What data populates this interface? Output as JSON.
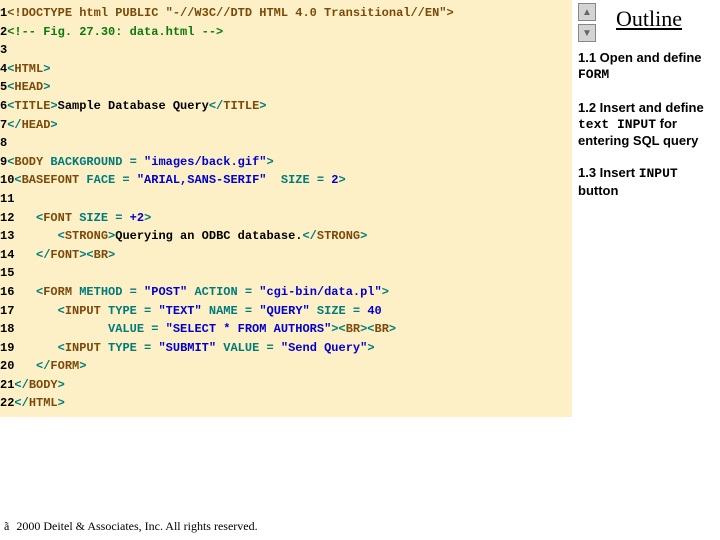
{
  "code": {
    "lines": [
      {
        "n": "1",
        "segs": [
          {
            "t": "<!DOCTYPE html PUBLIC \"-//W3C//DTD HTML 4.0 Transitional//EN\">",
            "c": "c-brown"
          }
        ]
      },
      {
        "n": "2",
        "segs": [
          {
            "t": "<!-- Fig. 27.30: data.html -->",
            "c": "c-green"
          }
        ]
      },
      {
        "n": "3",
        "segs": []
      },
      {
        "n": "4",
        "segs": [
          {
            "t": "<",
            "c": "c-teal"
          },
          {
            "t": "HTML",
            "c": "c-brown"
          },
          {
            "t": ">",
            "c": "c-teal"
          }
        ]
      },
      {
        "n": "5",
        "segs": [
          {
            "t": "<",
            "c": "c-teal"
          },
          {
            "t": "HEAD",
            "c": "c-brown"
          },
          {
            "t": ">",
            "c": "c-teal"
          }
        ]
      },
      {
        "n": "6",
        "segs": [
          {
            "t": "<",
            "c": "c-teal"
          },
          {
            "t": "TITLE",
            "c": "c-brown"
          },
          {
            "t": ">",
            "c": "c-teal"
          },
          {
            "t": "Sample Database Query",
            "c": "c-black"
          },
          {
            "t": "</",
            "c": "c-teal"
          },
          {
            "t": "TITLE",
            "c": "c-brown"
          },
          {
            "t": ">",
            "c": "c-teal"
          }
        ]
      },
      {
        "n": "7",
        "segs": [
          {
            "t": "</",
            "c": "c-teal"
          },
          {
            "t": "HEAD",
            "c": "c-brown"
          },
          {
            "t": ">",
            "c": "c-teal"
          }
        ]
      },
      {
        "n": "8",
        "segs": []
      },
      {
        "n": "9",
        "segs": [
          {
            "t": "<",
            "c": "c-teal"
          },
          {
            "t": "BODY ",
            "c": "c-brown"
          },
          {
            "t": "BACKGROUND = ",
            "c": "c-teal"
          },
          {
            "t": "\"images/back.gif\"",
            "c": "c-blue"
          },
          {
            "t": ">",
            "c": "c-teal"
          }
        ]
      },
      {
        "n": "10",
        "segs": [
          {
            "t": "<",
            "c": "c-teal"
          },
          {
            "t": "BASEFONT ",
            "c": "c-brown"
          },
          {
            "t": "FACE = ",
            "c": "c-teal"
          },
          {
            "t": "\"ARIAL,SANS-SERIF\" ",
            "c": "c-blue"
          },
          {
            "t": " SIZE = ",
            "c": "c-teal"
          },
          {
            "t": "2",
            "c": "c-blue"
          },
          {
            "t": ">",
            "c": "c-teal"
          }
        ]
      },
      {
        "n": "11",
        "segs": []
      },
      {
        "n": "12",
        "segs": [
          {
            "t": "   <",
            "c": "c-teal"
          },
          {
            "t": "FONT ",
            "c": "c-brown"
          },
          {
            "t": "SIZE = ",
            "c": "c-teal"
          },
          {
            "t": "+2",
            "c": "c-blue"
          },
          {
            "t": ">",
            "c": "c-teal"
          }
        ]
      },
      {
        "n": "13",
        "segs": [
          {
            "t": "      <",
            "c": "c-teal"
          },
          {
            "t": "STRONG",
            "c": "c-brown"
          },
          {
            "t": ">",
            "c": "c-teal"
          },
          {
            "t": "Querying an ODBC database.",
            "c": "c-black"
          },
          {
            "t": "</",
            "c": "c-teal"
          },
          {
            "t": "STRONG",
            "c": "c-brown"
          },
          {
            "t": ">",
            "c": "c-teal"
          }
        ]
      },
      {
        "n": "14",
        "segs": [
          {
            "t": "   </",
            "c": "c-teal"
          },
          {
            "t": "FONT",
            "c": "c-brown"
          },
          {
            "t": "><",
            "c": "c-teal"
          },
          {
            "t": "BR",
            "c": "c-brown"
          },
          {
            "t": ">",
            "c": "c-teal"
          }
        ]
      },
      {
        "n": "15",
        "segs": []
      },
      {
        "n": "16",
        "segs": [
          {
            "t": "   <",
            "c": "c-teal"
          },
          {
            "t": "FORM ",
            "c": "c-brown"
          },
          {
            "t": "METHOD = ",
            "c": "c-teal"
          },
          {
            "t": "\"POST\" ",
            "c": "c-blue"
          },
          {
            "t": "ACTION = ",
            "c": "c-teal"
          },
          {
            "t": "\"cgi-bin/data.pl\"",
            "c": "c-blue"
          },
          {
            "t": ">",
            "c": "c-teal"
          }
        ]
      },
      {
        "n": "17",
        "segs": [
          {
            "t": "      <",
            "c": "c-teal"
          },
          {
            "t": "INPUT ",
            "c": "c-brown"
          },
          {
            "t": "TYPE = ",
            "c": "c-teal"
          },
          {
            "t": "\"TEXT\" ",
            "c": "c-blue"
          },
          {
            "t": "NAME = ",
            "c": "c-teal"
          },
          {
            "t": "\"QUERY\" ",
            "c": "c-blue"
          },
          {
            "t": "SIZE = ",
            "c": "c-teal"
          },
          {
            "t": "40",
            "c": "c-blue"
          }
        ]
      },
      {
        "n": "18",
        "segs": [
          {
            "t": "             VALUE = ",
            "c": "c-teal"
          },
          {
            "t": "\"SELECT * FROM AUTHORS\"",
            "c": "c-blue"
          },
          {
            "t": "><",
            "c": "c-teal"
          },
          {
            "t": "BR",
            "c": "c-brown"
          },
          {
            "t": "><",
            "c": "c-teal"
          },
          {
            "t": "BR",
            "c": "c-brown"
          },
          {
            "t": ">",
            "c": "c-teal"
          }
        ]
      },
      {
        "n": "19",
        "segs": [
          {
            "t": "      <",
            "c": "c-teal"
          },
          {
            "t": "INPUT ",
            "c": "c-brown"
          },
          {
            "t": "TYPE = ",
            "c": "c-teal"
          },
          {
            "t": "\"SUBMIT\" ",
            "c": "c-blue"
          },
          {
            "t": "VALUE = ",
            "c": "c-teal"
          },
          {
            "t": "\"Send Query\"",
            "c": "c-blue"
          },
          {
            "t": ">",
            "c": "c-teal"
          }
        ]
      },
      {
        "n": "20",
        "segs": [
          {
            "t": "   </",
            "c": "c-teal"
          },
          {
            "t": "FORM",
            "c": "c-brown"
          },
          {
            "t": ">",
            "c": "c-teal"
          }
        ]
      },
      {
        "n": "21",
        "segs": [
          {
            "t": "</",
            "c": "c-teal"
          },
          {
            "t": "BODY",
            "c": "c-brown"
          },
          {
            "t": ">",
            "c": "c-teal"
          }
        ]
      },
      {
        "n": "22",
        "segs": [
          {
            "t": "</",
            "c": "c-teal"
          },
          {
            "t": "HTML",
            "c": "c-brown"
          },
          {
            "t": ">",
            "c": "c-teal"
          }
        ]
      }
    ]
  },
  "sidebar": {
    "title": "Outline",
    "nav_up": "▲",
    "nav_down": "▼",
    "notes": [
      {
        "prefix": "1.1 ",
        "bold": "Open and define ",
        "mono": "FORM",
        "rest": ""
      },
      {
        "prefix": "1.2 ",
        "bold": "Insert and define ",
        "mono": "text INPUT",
        "rest": " for entering SQL query"
      },
      {
        "prefix": "1.3 ",
        "bold": "Insert ",
        "mono": "INPUT",
        "rest": " button"
      }
    ]
  },
  "footer": {
    "symbol": "ã",
    "text": " 2000 Deitel & Associates, Inc.  All rights reserved."
  }
}
